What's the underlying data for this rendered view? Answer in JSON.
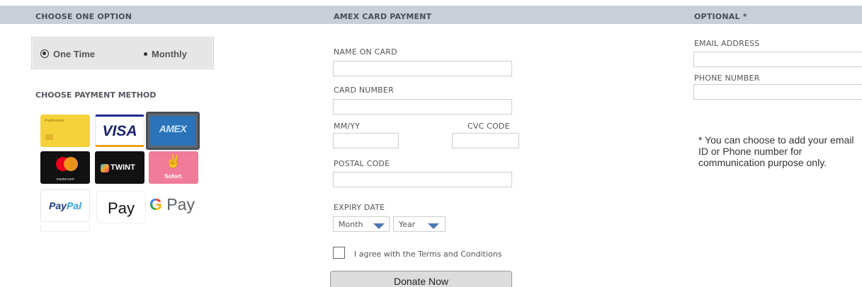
{
  "columns": {
    "left_title": "CHOOSE ONE OPTION",
    "middle_title": "AMEX CARD PAYMENT",
    "right_title": "OPTIONAL *"
  },
  "frequency": {
    "one_time": "One Time",
    "monthly": "Monthly",
    "selected": "One Time"
  },
  "payment_methods": {
    "title": "CHOOSE PAYMENT METHOD",
    "selected": "amex",
    "postfinance_label": "PostFinance",
    "visa_label": "VISA",
    "amex_label": "AMEX",
    "mastercard_label": "mastercard",
    "twint_label": "TWINT",
    "sofort_label": "Sofort.",
    "paypal_label_a": "Pay",
    "paypal_label_b": "Pal",
    "applepay_label": "Pay",
    "gpay_g": "G",
    "gpay_label": " Pay"
  },
  "form": {
    "name_label": "NAME ON CARD",
    "name_value": "",
    "card_label": "CARD NUMBER",
    "card_value": "",
    "mmyy_label": "MM/YY",
    "mmyy_value": "",
    "cvc_label": "CVC CODE",
    "cvc_value": "",
    "postal_label": "POSTAL CODE",
    "postal_value": "",
    "expiry_label": "EXPIRY DATE",
    "month_value": "Month",
    "year_value": "Year",
    "terms_label": "I agree with the Terms and Conditions",
    "terms_checked": false,
    "donate_label": "Donate Now"
  },
  "optional": {
    "email_label": "EMAIL ADDRESS",
    "email_value": "",
    "phone_label": "PHONE NUMBER",
    "phone_value": "",
    "note": "* You can choose to add your email ID or Phone number for communication purpose only."
  },
  "colors": {
    "header_bar": "#c9cfd8",
    "selected_tile_border": "#4a4f57",
    "dropdown_caret": "#4d78b4"
  }
}
